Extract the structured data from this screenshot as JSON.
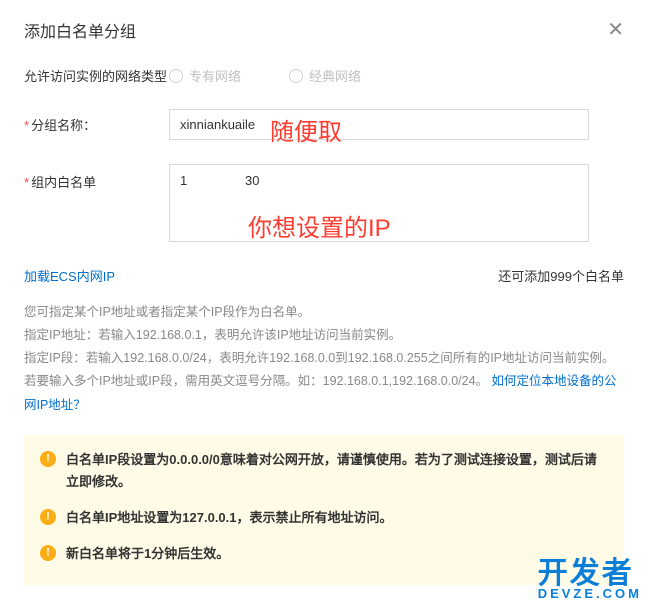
{
  "modal": {
    "title": "添加白名单分组"
  },
  "networkType": {
    "label": "允许访问实例的网络类型",
    "option1": "专有网络",
    "option2": "经典网络"
  },
  "groupName": {
    "label": "分组名称：",
    "value": "xinniankuaile"
  },
  "whitelist": {
    "label": "组内白名单",
    "valueLeft": "1",
    "valueRight": "30"
  },
  "linkRow": {
    "loadEcs": "加载ECS内网IP",
    "remaining": "还可添加999个白名单"
  },
  "info": {
    "line1": "您可指定某个IP地址或者指定某个IP段作为白名单。",
    "line2": "指定IP地址：若输入192.168.0.1，表明允许该IP地址访问当前实例。",
    "line3": "指定IP段：若输入192.168.0.0/24，表明允许192.168.0.0到192.168.0.255之间所有的IP地址访问当前实例。",
    "line4a": "若要输入多个IP地址或IP段，需用英文逗号分隔。如：192.168.0.1,192.168.0.0/24。",
    "line4link": "如何定位本地设备的公网IP地址？"
  },
  "warnings": {
    "w1": "白名单IP段设置为0.0.0.0/0意味着对公网开放，请谨慎使用。若为了测试连接设置，测试后请立即修改。",
    "w2": "白名单IP地址设置为127.0.0.1，表示禁止所有地址访问。",
    "w3": "新白名单将于1分钟后生效。"
  },
  "annotations": {
    "a1": "随便取",
    "a2": "你想设置的IP"
  },
  "watermark": {
    "cn": "开发者",
    "en": "DEVZE.COM"
  }
}
